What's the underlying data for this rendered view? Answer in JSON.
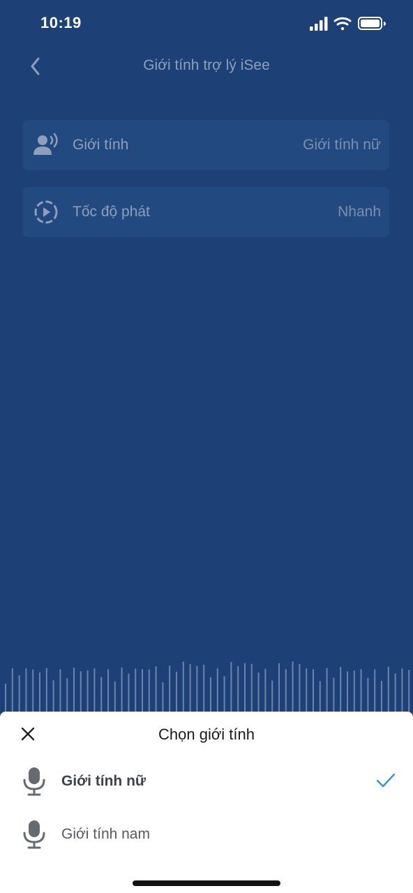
{
  "status_bar": {
    "time": "10:19",
    "icons": [
      "signal-icon",
      "wifi-icon",
      "battery-icon"
    ]
  },
  "nav": {
    "back_icon": "chevron-left-icon",
    "title": "Giới tính trợ lý iSee"
  },
  "settings": [
    {
      "icon": "speaking-person-icon",
      "label": "Giới tính",
      "value": "Giới tính nữ"
    },
    {
      "icon": "play-circle-icon",
      "label": "Tốc độ phát",
      "value": "Nhanh"
    }
  ],
  "sheet": {
    "close_icon": "close-icon",
    "title": "Chọn giới tính",
    "options": [
      {
        "icon": "microphone-icon",
        "label": "Giới tính nữ",
        "selected": true
      },
      {
        "icon": "microphone-icon",
        "label": "Giới tính nam",
        "selected": false
      }
    ],
    "check_icon": "checkmark-icon"
  },
  "colors": {
    "background": "#1d4177",
    "row_background": "#234981",
    "accent_check": "#3d8fd6",
    "waveform": "#6d84ab",
    "sheet_background": "#ffffff"
  }
}
